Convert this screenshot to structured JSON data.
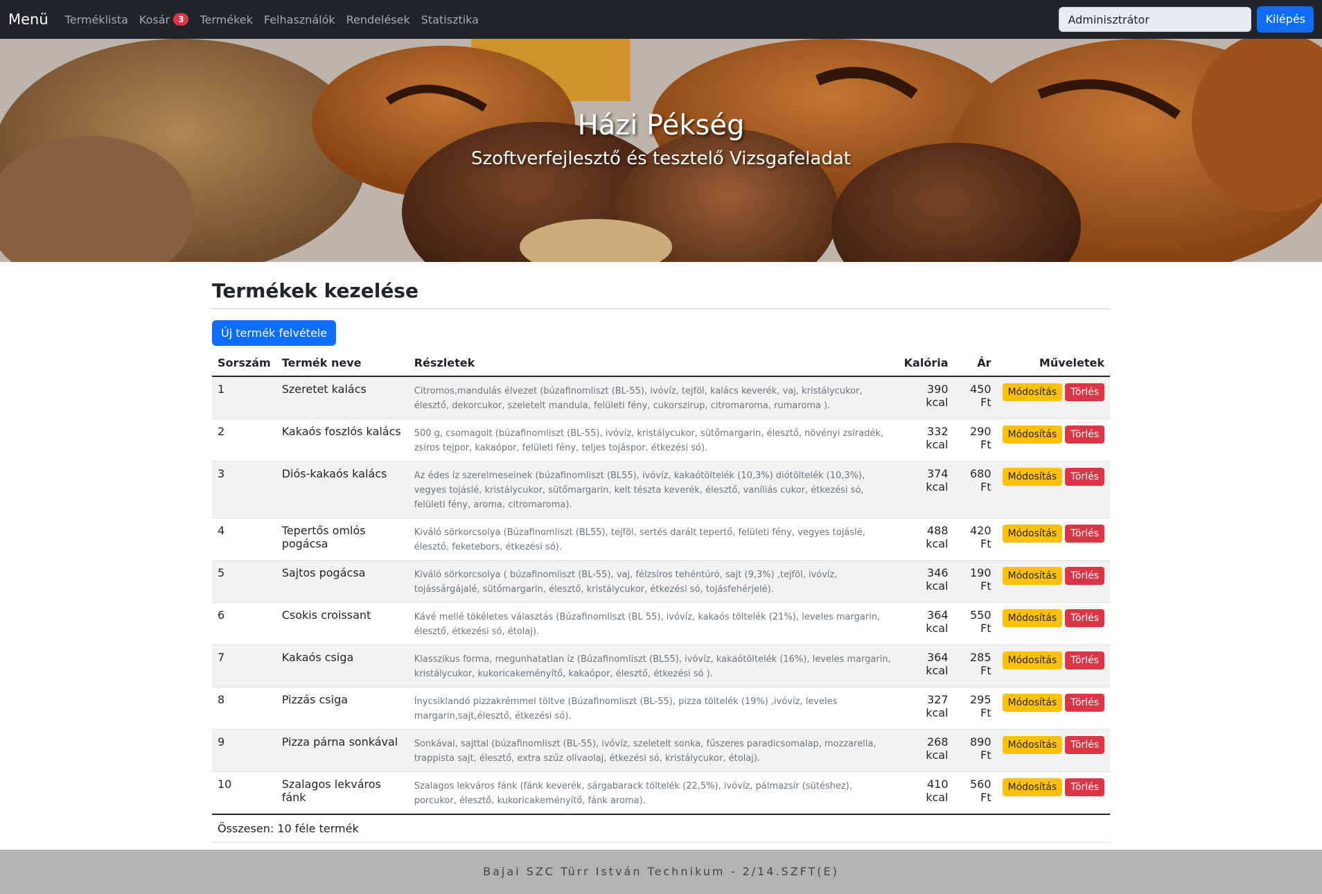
{
  "navbar": {
    "brand": "Menü",
    "links": [
      "Terméklista",
      "Kosár",
      "Termékek",
      "Felhasználók",
      "Rendelések",
      "Statisztika"
    ],
    "cart_badge": "3",
    "user_label": "Adminisztrátor",
    "logout_label": "Kilépés"
  },
  "hero": {
    "title": "Házi Pékség",
    "subtitle": "Szoftverfejlesztő és tesztelő Vizsgafeladat"
  },
  "main": {
    "title": "Termékek kezelése",
    "new_button": "Új termék felvétele",
    "columns": [
      "Sorszám",
      "Termék neve",
      "Részletek",
      "Kalória",
      "Ár",
      "Műveletek"
    ],
    "modify_label": "Módosítás",
    "delete_label": "Törlés",
    "rows": [
      {
        "num": "1",
        "name": "Szeretet kalács",
        "details": "Citromos,mandulás élvezet (búzafinomliszt (BL-55), ivóvíz, tejföl, kalács keverék, vaj, kristálycukor, élesztő, dekorcukor, szeletelt mandula, felületi fény, cukorszirup, citromaroma, rumaroma ).",
        "kcal": "390 kcal",
        "price": "450 Ft"
      },
      {
        "num": "2",
        "name": "Kakaós foszlós kalács",
        "details": "500 g, csomagolt (búzafinomliszt (BL-55), ivóvíz, kristálycukor, sütőmargarin, élesztő, növényi zsiradék, zsíros tejpor, kakaópor, felületi fény, teljes tojáspor, étkezési só).",
        "kcal": "332 kcal",
        "price": "290 Ft"
      },
      {
        "num": "3",
        "name": "Diós-kakaós kalács",
        "details": "Az édes íz szerelmeseinek (búzafinomliszt (BL55), ivóvíz, kakaótöltelék (10,3%) diótöltelék (10,3%), vegyes tojáslé, kristálycukor, sütőmargarin, kelt tészta keverék, élesztő, vaníliás cukor, étkezési só, felületi fény, aroma, citromaroma).",
        "kcal": "374 kcal",
        "price": "680 Ft"
      },
      {
        "num": "4",
        "name": "Tepertős omlós pogácsa",
        "details": "Kiváló sörkorcsolya (Búzafinomliszt (BL55), tejföl, sertés darált tepertő, felületi fény, vegyes tojáslé, élesztő, feketebors, étkezési só).",
        "kcal": "488 kcal",
        "price": "420 Ft"
      },
      {
        "num": "5",
        "name": "Sajtos pogácsa",
        "details": "Kiváló sörkorcsolya ( búzafinomliszt (BL-55), vaj, félzsíros tehéntúró, sajt (9,3%) ,tejföl, ivóvíz, tojássárgájalé, sütőmargarin, élesztő, kristálycukor, étkezési só, tojásfehérjelé).",
        "kcal": "346 kcal",
        "price": "190 Ft"
      },
      {
        "num": "6",
        "name": "Csokis croissant",
        "details": "Kávé mellé tökéletes választás (Búzafinomliszt (BL 55), ivóvíz, kakaós töltelék (21%), leveles margarin, élesztő, étkezési só, étolaj).",
        "kcal": "364 kcal",
        "price": "550 Ft"
      },
      {
        "num": "7",
        "name": "Kakaós csiga",
        "details": "Klasszikus forma, megunhatatlan íz (Búzafinomliszt (BL55), ivóvíz, kakaótöltelék (16%), leveles margarin, kristálycukor, kukoricakeményítő, kakaópor, élesztő, étkezési só ).",
        "kcal": "364 kcal",
        "price": "285 Ft"
      },
      {
        "num": "8",
        "name": "Pizzás csiga",
        "details": "Ínycsiklandó pizzakrémmel töltve (Búzafinomliszt (BL-55), pizza töltelék (19%) ,ivóvíz, leveles margarin,sajt,élesztő, étkezési só).",
        "kcal": "327 kcal",
        "price": "295 Ft"
      },
      {
        "num": "9",
        "name": "Pizza párna sonkával",
        "details": "Sonkával, sajttal (búzafinomliszt (BL-55), ivóvíz, szeletelt sonka, fűszeres paradicsomalap, mozzarella, trappista sajt, élesztő, extra szűz olívaolaj, étkezési só, kristálycukor, étolaj).",
        "kcal": "268 kcal",
        "price": "890 Ft"
      },
      {
        "num": "10",
        "name": "Szalagos lekváros fánk",
        "details": "Szalagos lekváros fánk (fánk keverék, sárgabarack töltelék (22,5%), ivóvíz, pálmazsír (sütéshez), porcukor, élesztő, kukoricakeményítő, fánk aroma).",
        "kcal": "410 kcal",
        "price": "560 Ft"
      }
    ],
    "total_text": "Összesen: 10 féle termék"
  },
  "footer": {
    "text": "Bajai SZC Türr István Technikum - 2/14.SZFT(E)"
  }
}
